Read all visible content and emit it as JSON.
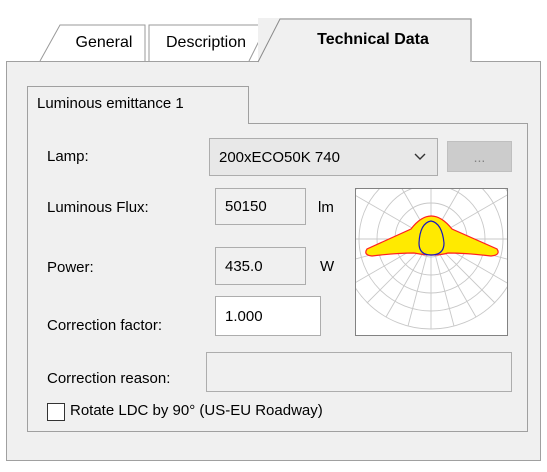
{
  "tabs": [
    {
      "label": "General",
      "selected": false
    },
    {
      "label": "Description",
      "selected": false
    },
    {
      "label": "Technical Data",
      "selected": true
    }
  ],
  "inner_tab": {
    "label": "Luminous emittance 1"
  },
  "lamp": {
    "label": "Lamp:",
    "value": "200xECO50K 740",
    "more_button": "..."
  },
  "luminous_flux": {
    "label": "Luminous Flux:",
    "value": "50150",
    "unit": "lm"
  },
  "power": {
    "label": "Power:",
    "value": "435.0",
    "unit": "W"
  },
  "correction_factor": {
    "label": "Correction factor:",
    "value": "1.000"
  },
  "correction_reason": {
    "label": "Correction reason:",
    "value": ""
  },
  "rotate_ldc": {
    "label": "Rotate LDC by 90° (US-EU Roadway)",
    "checked": false
  },
  "ldc": {
    "icon": "light-distribution-curve",
    "colors": {
      "c0_c180": "#ffea00",
      "outline": "#ff2020",
      "c90_c270": "#1818c0"
    }
  }
}
